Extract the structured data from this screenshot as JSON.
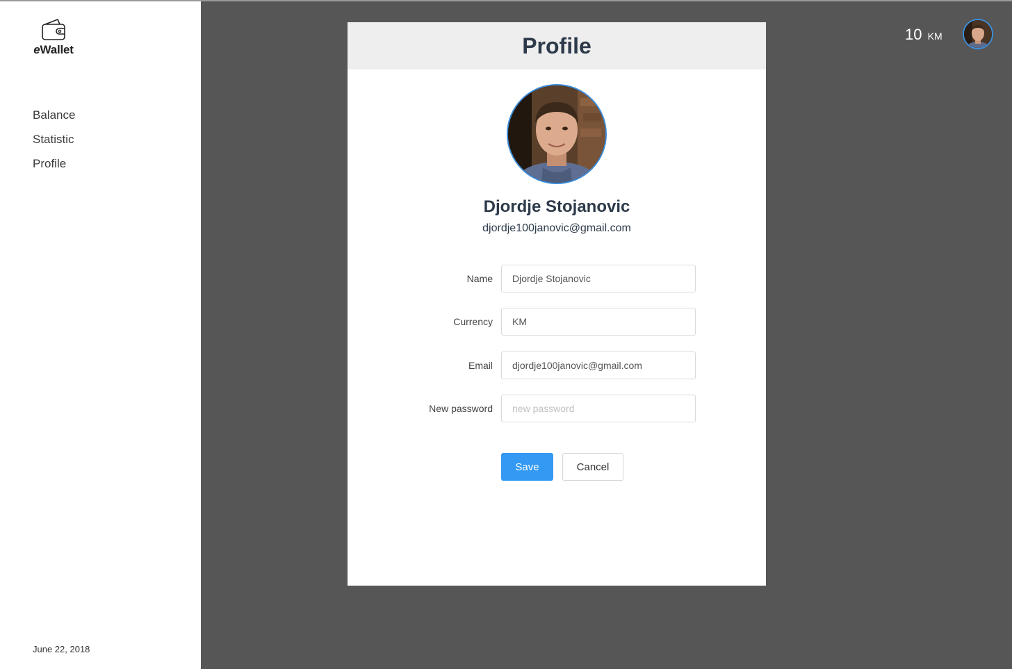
{
  "app": {
    "name_italic": "e",
    "name_rest": "Wallet"
  },
  "sidebar": {
    "items": [
      {
        "label": "Balance"
      },
      {
        "label": "Statistic"
      },
      {
        "label": "Profile"
      }
    ],
    "date": "June 22, 2018"
  },
  "topbar": {
    "balance_amount": "10",
    "balance_currency": "KM"
  },
  "profile": {
    "title": "Profile",
    "name": "Djordje Stojanovic",
    "email": "djordje100janovic@gmail.com"
  },
  "form": {
    "name_label": "Name",
    "name_value": "Djordje Stojanovic",
    "currency_label": "Currency",
    "currency_value": "KM",
    "email_label": "Email",
    "email_value": "djordje100janovic@gmail.com",
    "password_label": "New password",
    "password_placeholder": "new password",
    "save_label": "Save",
    "cancel_label": "Cancel"
  },
  "colors": {
    "accent": "#3399f3",
    "avatar_border": "#3b8ddb",
    "background": "#565656",
    "heading": "#2d3a4a"
  },
  "icons": {
    "logo": "wallet-icon"
  }
}
